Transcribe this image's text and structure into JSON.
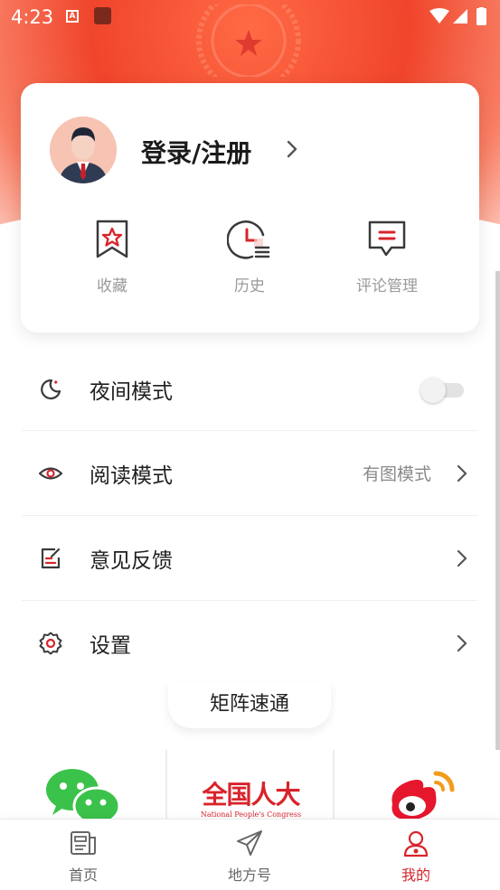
{
  "status_bar": {
    "time": "4:23",
    "notification_letter": "A"
  },
  "profile": {
    "login_label": "登录/注册"
  },
  "quick_actions": [
    {
      "label": "收藏",
      "icon": "bookmark-star-icon"
    },
    {
      "label": "历史",
      "icon": "history-clock-icon"
    },
    {
      "label": "评论管理",
      "icon": "comment-icon"
    }
  ],
  "settings": {
    "night_mode": {
      "label": "夜间模式",
      "icon": "moon-icon",
      "enabled": false
    },
    "reading_mode": {
      "label": "阅读模式",
      "icon": "eye-icon",
      "value": "有图模式"
    },
    "feedback": {
      "label": "意见反馈",
      "icon": "edit-icon"
    },
    "settings": {
      "label": "设置",
      "icon": "gear-icon"
    }
  },
  "matrix": {
    "title": "矩阵速通",
    "logo_text": "全国人大",
    "logo_subtext": "National People's Congress"
  },
  "bottom_nav": [
    {
      "label": "首页",
      "icon": "newspaper-icon",
      "active": false
    },
    {
      "label": "地方号",
      "icon": "paper-plane-icon",
      "active": false
    },
    {
      "label": "我的",
      "icon": "user-icon",
      "active": true
    }
  ],
  "colors": {
    "accent": "#d8242b",
    "hero": "#f0452b"
  }
}
